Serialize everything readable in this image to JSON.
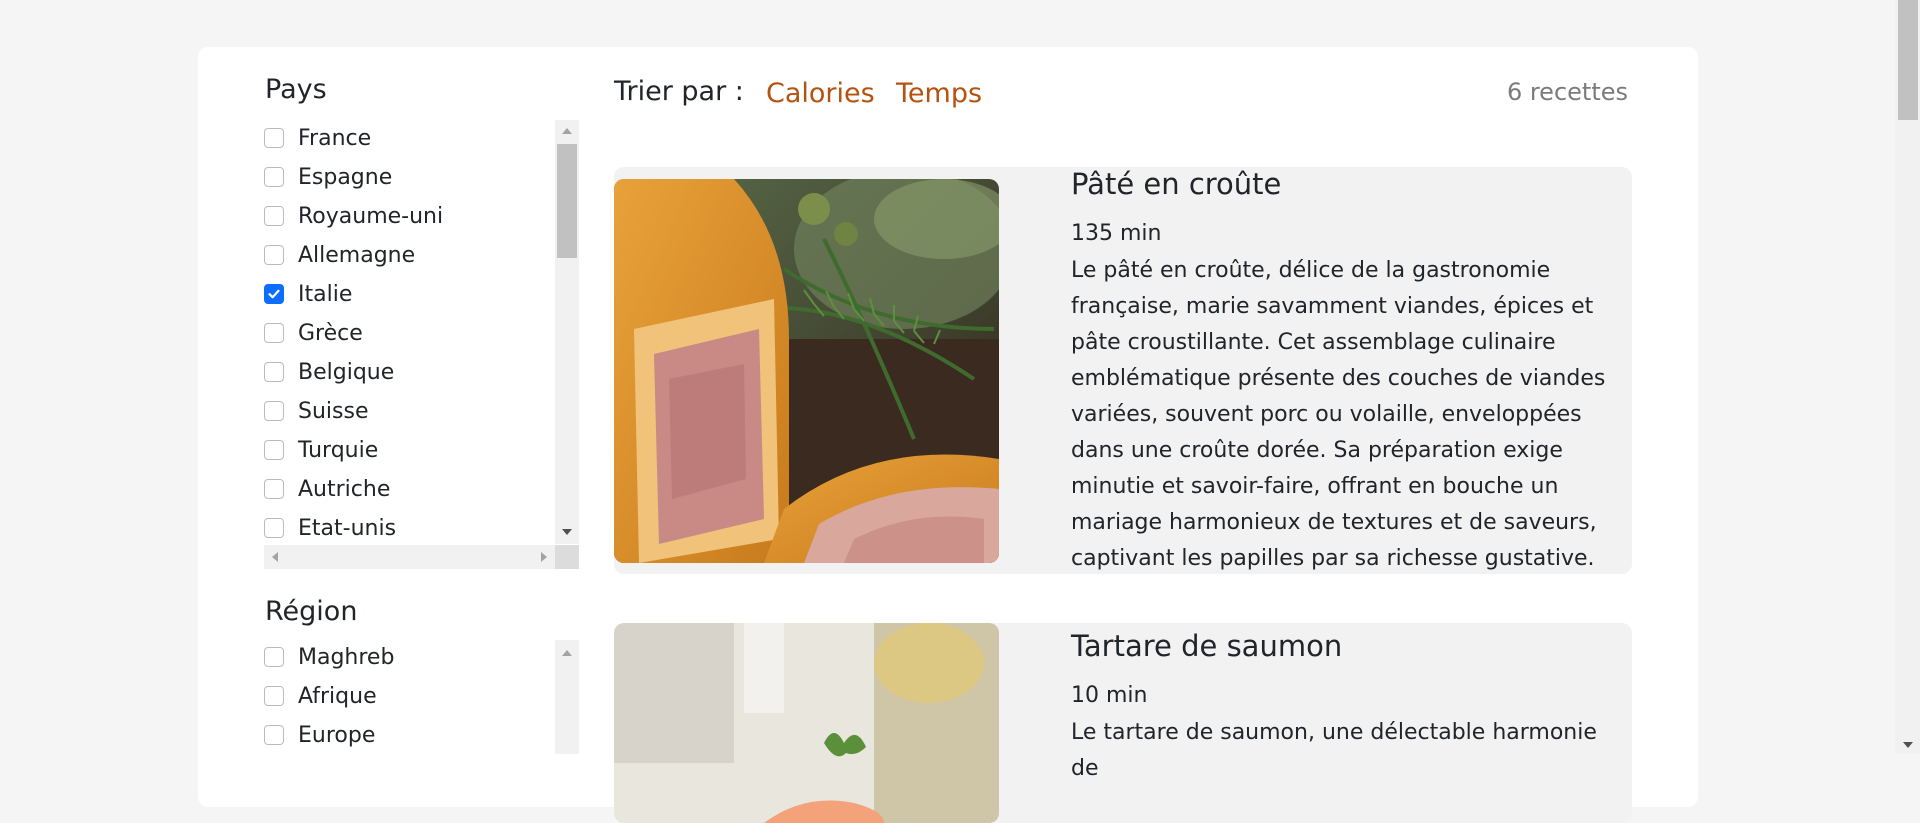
{
  "filters": {
    "pays": {
      "title": "Pays",
      "options": [
        {
          "label": "France",
          "checked": false
        },
        {
          "label": "Espagne",
          "checked": false
        },
        {
          "label": "Royaume-uni",
          "checked": false
        },
        {
          "label": "Allemagne",
          "checked": false
        },
        {
          "label": "Italie",
          "checked": true
        },
        {
          "label": "Grèce",
          "checked": false
        },
        {
          "label": "Belgique",
          "checked": false
        },
        {
          "label": "Suisse",
          "checked": false
        },
        {
          "label": "Turquie",
          "checked": false
        },
        {
          "label": "Autriche",
          "checked": false
        },
        {
          "label": "Etat-unis",
          "checked": false
        }
      ]
    },
    "region": {
      "title": "Région",
      "options": [
        {
          "label": "Maghreb",
          "checked": false
        },
        {
          "label": "Afrique",
          "checked": false
        },
        {
          "label": "Europe",
          "checked": false
        }
      ]
    }
  },
  "sort": {
    "label": "Trier par :",
    "options": [
      "Calories",
      "Temps"
    ]
  },
  "results": {
    "count_label": "6 recettes"
  },
  "recipes": [
    {
      "title": "Pâté en croûte",
      "time": "135 min",
      "description": "Le pâté en croûte, délice de la gastronomie française, marie savamment viandes, épices et pâte croustillante. Cet assemblage culinaire emblématique présente des couches de viandes variées, souvent porc ou volaille, enveloppées dans une croûte dorée. Sa préparation exige minutie et savoir-faire, offrant en bouche un mariage harmonieux de textures et de saveurs, captivant les papilles par sa richesse gustative."
    },
    {
      "title": "Tartare de saumon",
      "time": "10 min",
      "description": "Le tartare de saumon, une délectable harmonie de"
    }
  ],
  "colors": {
    "accent_link": "#b5520f",
    "checkbox_checked": "#0d6efd",
    "card_bg": "#f2f2f2"
  }
}
